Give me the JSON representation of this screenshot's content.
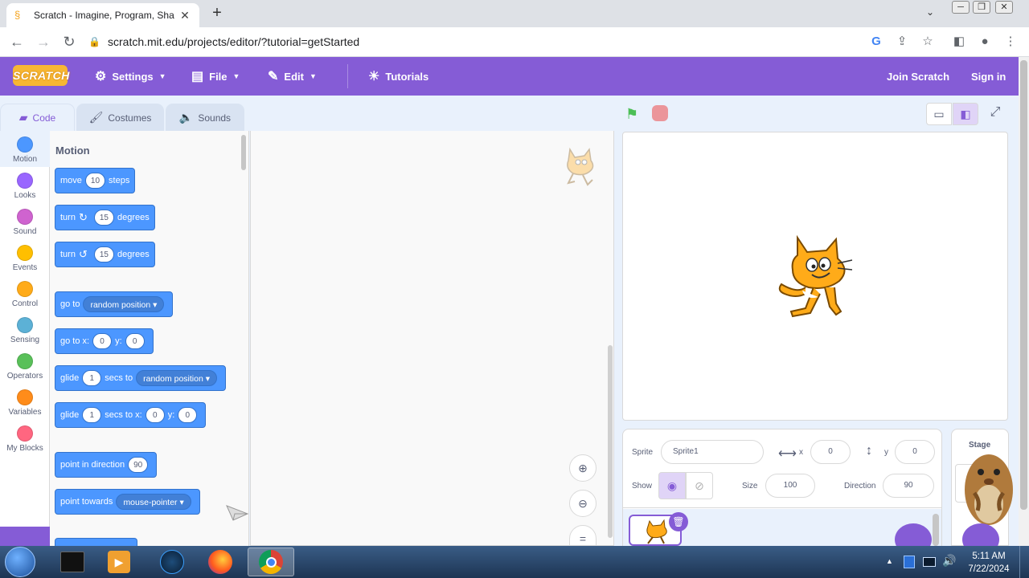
{
  "browser": {
    "tab_title": "Scratch - Imagine, Program, Sha",
    "url": "scratch.mit.edu/projects/editor/?tutorial=getStarted"
  },
  "menubar": {
    "logo": "SCRATCH",
    "settings": "Settings",
    "file": "File",
    "edit": "Edit",
    "tutorials": "Tutorials",
    "join": "Join Scratch",
    "signin": "Sign in"
  },
  "tabs": {
    "code": "Code",
    "costumes": "Costumes",
    "sounds": "Sounds"
  },
  "categories": [
    {
      "label": "Motion",
      "color": "#4c97ff"
    },
    {
      "label": "Looks",
      "color": "#9966ff"
    },
    {
      "label": "Sound",
      "color": "#cf63cf"
    },
    {
      "label": "Events",
      "color": "#ffbf00"
    },
    {
      "label": "Control",
      "color": "#ffab19"
    },
    {
      "label": "Sensing",
      "color": "#5cb1d6"
    },
    {
      "label": "Operators",
      "color": "#59c059"
    },
    {
      "label": "Variables",
      "color": "#ff8c1a"
    },
    {
      "label": "My Blocks",
      "color": "#ff6680"
    }
  ],
  "palette": {
    "title": "Motion",
    "move": {
      "a": "move",
      "v": "10",
      "b": "steps"
    },
    "turn_right": {
      "a": "turn",
      "v": "15",
      "b": "degrees"
    },
    "turn_left": {
      "a": "turn",
      "v": "15",
      "b": "degrees"
    },
    "goto": {
      "a": "go to",
      "d": "random position"
    },
    "gotoxy": {
      "a": "go to x:",
      "x": "0",
      "b": "y:",
      "y": "0"
    },
    "glide_to": {
      "a": "glide",
      "v": "1",
      "b": "secs to",
      "d": "random position"
    },
    "glide_xy": {
      "a": "glide",
      "v": "1",
      "b": "secs to x:",
      "x": "0",
      "c": "y:",
      "y": "0"
    },
    "point_dir": {
      "a": "point in direction",
      "v": "90"
    },
    "point_towards": {
      "a": "point towards",
      "d": "mouse-pointer"
    }
  },
  "sprite_info": {
    "sprite_label": "Sprite",
    "sprite_name": "Sprite1",
    "x_label": "x",
    "x": "0",
    "y_label": "y",
    "y": "0",
    "show_label": "Show",
    "size_label": "Size",
    "size": "100",
    "direction_label": "Direction",
    "direction": "90"
  },
  "stage_pane": {
    "label": "Stage"
  },
  "taskbar": {
    "time": "5:11 AM",
    "date": "7/22/2024"
  }
}
